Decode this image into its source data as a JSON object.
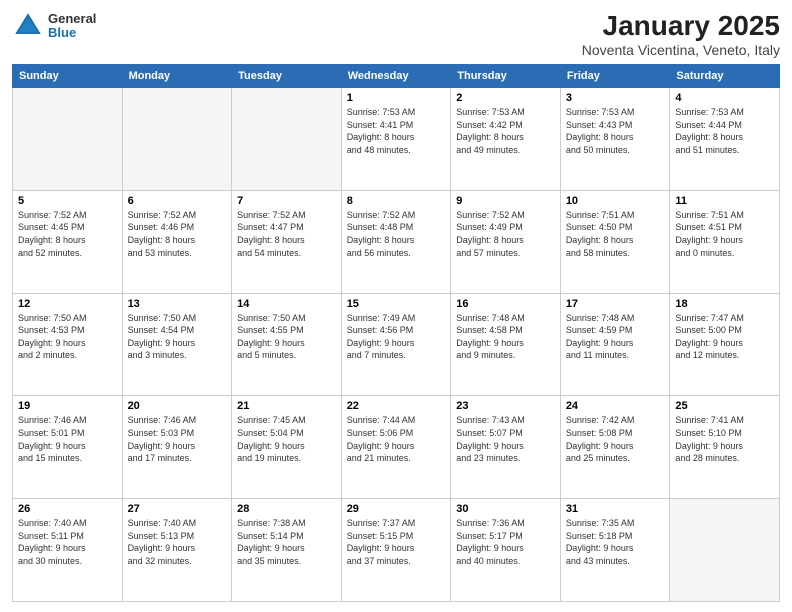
{
  "header": {
    "logo": {
      "general": "General",
      "blue": "Blue"
    },
    "month": "January 2025",
    "location": "Noventa Vicentina, Veneto, Italy"
  },
  "weekdays": [
    "Sunday",
    "Monday",
    "Tuesday",
    "Wednesday",
    "Thursday",
    "Friday",
    "Saturday"
  ],
  "weeks": [
    [
      {
        "day": "",
        "info": ""
      },
      {
        "day": "",
        "info": ""
      },
      {
        "day": "",
        "info": ""
      },
      {
        "day": "1",
        "info": "Sunrise: 7:53 AM\nSunset: 4:41 PM\nDaylight: 8 hours\nand 48 minutes."
      },
      {
        "day": "2",
        "info": "Sunrise: 7:53 AM\nSunset: 4:42 PM\nDaylight: 8 hours\nand 49 minutes."
      },
      {
        "day": "3",
        "info": "Sunrise: 7:53 AM\nSunset: 4:43 PM\nDaylight: 8 hours\nand 50 minutes."
      },
      {
        "day": "4",
        "info": "Sunrise: 7:53 AM\nSunset: 4:44 PM\nDaylight: 8 hours\nand 51 minutes."
      }
    ],
    [
      {
        "day": "5",
        "info": "Sunrise: 7:52 AM\nSunset: 4:45 PM\nDaylight: 8 hours\nand 52 minutes."
      },
      {
        "day": "6",
        "info": "Sunrise: 7:52 AM\nSunset: 4:46 PM\nDaylight: 8 hours\nand 53 minutes."
      },
      {
        "day": "7",
        "info": "Sunrise: 7:52 AM\nSunset: 4:47 PM\nDaylight: 8 hours\nand 54 minutes."
      },
      {
        "day": "8",
        "info": "Sunrise: 7:52 AM\nSunset: 4:48 PM\nDaylight: 8 hours\nand 56 minutes."
      },
      {
        "day": "9",
        "info": "Sunrise: 7:52 AM\nSunset: 4:49 PM\nDaylight: 8 hours\nand 57 minutes."
      },
      {
        "day": "10",
        "info": "Sunrise: 7:51 AM\nSunset: 4:50 PM\nDaylight: 8 hours\nand 58 minutes."
      },
      {
        "day": "11",
        "info": "Sunrise: 7:51 AM\nSunset: 4:51 PM\nDaylight: 9 hours\nand 0 minutes."
      }
    ],
    [
      {
        "day": "12",
        "info": "Sunrise: 7:50 AM\nSunset: 4:53 PM\nDaylight: 9 hours\nand 2 minutes."
      },
      {
        "day": "13",
        "info": "Sunrise: 7:50 AM\nSunset: 4:54 PM\nDaylight: 9 hours\nand 3 minutes."
      },
      {
        "day": "14",
        "info": "Sunrise: 7:50 AM\nSunset: 4:55 PM\nDaylight: 9 hours\nand 5 minutes."
      },
      {
        "day": "15",
        "info": "Sunrise: 7:49 AM\nSunset: 4:56 PM\nDaylight: 9 hours\nand 7 minutes."
      },
      {
        "day": "16",
        "info": "Sunrise: 7:48 AM\nSunset: 4:58 PM\nDaylight: 9 hours\nand 9 minutes."
      },
      {
        "day": "17",
        "info": "Sunrise: 7:48 AM\nSunset: 4:59 PM\nDaylight: 9 hours\nand 11 minutes."
      },
      {
        "day": "18",
        "info": "Sunrise: 7:47 AM\nSunset: 5:00 PM\nDaylight: 9 hours\nand 12 minutes."
      }
    ],
    [
      {
        "day": "19",
        "info": "Sunrise: 7:46 AM\nSunset: 5:01 PM\nDaylight: 9 hours\nand 15 minutes."
      },
      {
        "day": "20",
        "info": "Sunrise: 7:46 AM\nSunset: 5:03 PM\nDaylight: 9 hours\nand 17 minutes."
      },
      {
        "day": "21",
        "info": "Sunrise: 7:45 AM\nSunset: 5:04 PM\nDaylight: 9 hours\nand 19 minutes."
      },
      {
        "day": "22",
        "info": "Sunrise: 7:44 AM\nSunset: 5:06 PM\nDaylight: 9 hours\nand 21 minutes."
      },
      {
        "day": "23",
        "info": "Sunrise: 7:43 AM\nSunset: 5:07 PM\nDaylight: 9 hours\nand 23 minutes."
      },
      {
        "day": "24",
        "info": "Sunrise: 7:42 AM\nSunset: 5:08 PM\nDaylight: 9 hours\nand 25 minutes."
      },
      {
        "day": "25",
        "info": "Sunrise: 7:41 AM\nSunset: 5:10 PM\nDaylight: 9 hours\nand 28 minutes."
      }
    ],
    [
      {
        "day": "26",
        "info": "Sunrise: 7:40 AM\nSunset: 5:11 PM\nDaylight: 9 hours\nand 30 minutes."
      },
      {
        "day": "27",
        "info": "Sunrise: 7:40 AM\nSunset: 5:13 PM\nDaylight: 9 hours\nand 32 minutes."
      },
      {
        "day": "28",
        "info": "Sunrise: 7:38 AM\nSunset: 5:14 PM\nDaylight: 9 hours\nand 35 minutes."
      },
      {
        "day": "29",
        "info": "Sunrise: 7:37 AM\nSunset: 5:15 PM\nDaylight: 9 hours\nand 37 minutes."
      },
      {
        "day": "30",
        "info": "Sunrise: 7:36 AM\nSunset: 5:17 PM\nDaylight: 9 hours\nand 40 minutes."
      },
      {
        "day": "31",
        "info": "Sunrise: 7:35 AM\nSunset: 5:18 PM\nDaylight: 9 hours\nand 43 minutes."
      },
      {
        "day": "",
        "info": ""
      }
    ]
  ]
}
